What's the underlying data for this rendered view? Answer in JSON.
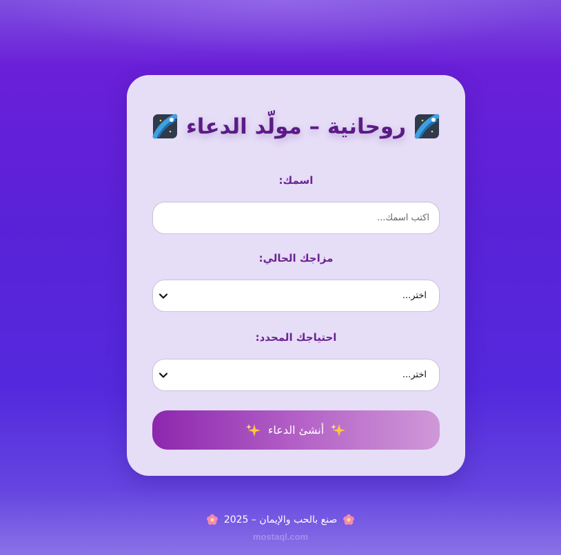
{
  "title": {
    "text": "روحانية – مولّد الدعاء",
    "icon": "comet-icon"
  },
  "form": {
    "name_label": "اسمك:",
    "name_placeholder": "اكتب اسمك...",
    "mood_label": "مزاجك الحالي:",
    "mood_selected": "اختر...",
    "need_label": "احتياجك المحدد:",
    "need_selected": "اختر...",
    "submit_label": "أنشئ الدعاء"
  },
  "footer": {
    "text": "صنع بالحب والإيمان – 2025"
  },
  "watermark": {
    "text": "mostaql.com"
  },
  "colors": {
    "accent": "#5b1b86",
    "button_start": "#8c27ae",
    "button_end": "#cf98d8",
    "card": "#e6ddf7"
  }
}
